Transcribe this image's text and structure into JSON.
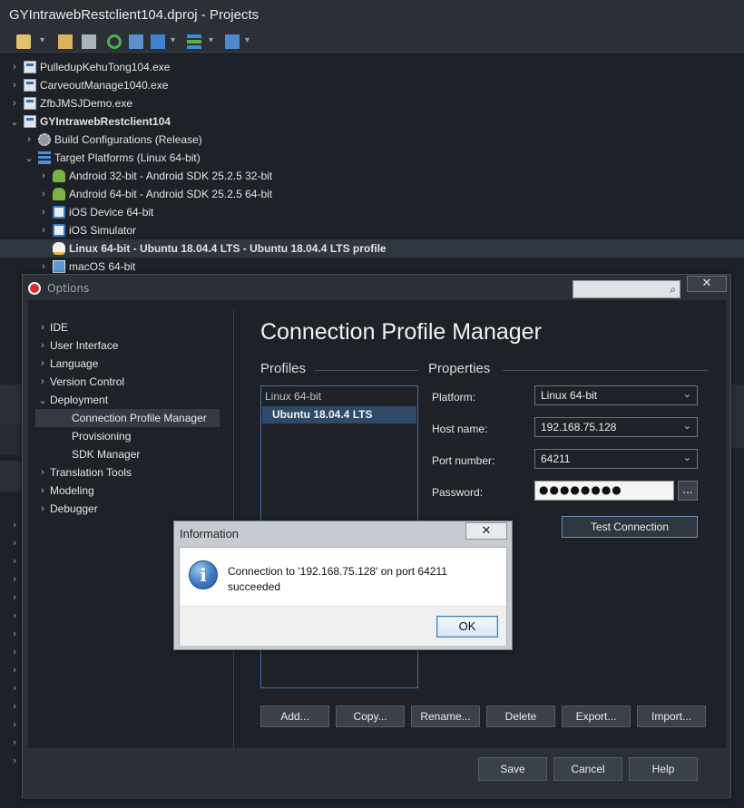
{
  "window": {
    "title": "GYIntrawebRestclient104.dproj - Projects"
  },
  "toolbar": {
    "icons": [
      "new-icon",
      "add-icon",
      "open-icon",
      "refresh-icon",
      "build-icon",
      "check-icon",
      "layers-icon",
      "deploy-icon"
    ]
  },
  "tree": {
    "items": [
      {
        "label": "PulledupKehuTong104.exe"
      },
      {
        "label": "CarveoutManage1040.exe"
      },
      {
        "label": "ZfbJMSJDemo.exe"
      },
      {
        "label": "GYIntrawebRestclient104"
      },
      {
        "label": "Build Configurations (Release)"
      },
      {
        "label": "Target Platforms (Linux 64-bit)"
      },
      {
        "label": "Android 32-bit - Android SDK 25.2.5 32-bit"
      },
      {
        "label": "Android 64-bit - Android SDK 25.2.5 64-bit"
      },
      {
        "label": "iOS Device 64-bit"
      },
      {
        "label": "iOS Simulator"
      },
      {
        "label": "Linux 64-bit - Ubuntu 18.04.4 LTS - Ubuntu 18.04.4 LTS profile"
      },
      {
        "label": "macOS 64-bit"
      }
    ]
  },
  "options": {
    "title": "Options",
    "search_placeholder": "",
    "close_label": "✕",
    "nav": [
      {
        "label": "IDE"
      },
      {
        "label": "User Interface"
      },
      {
        "label": "Language"
      },
      {
        "label": "Version Control"
      },
      {
        "label": "Deployment"
      },
      {
        "label": "Connection Profile Manager"
      },
      {
        "label": "Provisioning"
      },
      {
        "label": "SDK Manager"
      },
      {
        "label": "Translation Tools"
      },
      {
        "label": "Modeling"
      },
      {
        "label": "Debugger"
      }
    ],
    "page_title": "Connection Profile Manager",
    "profiles_heading": "Profiles",
    "properties_heading": "Properties",
    "profiles": {
      "group": "Linux 64-bit",
      "selected": "Ubuntu 18.04.4 LTS"
    },
    "properties": {
      "platform_label": "Platform:",
      "platform_value": "Linux 64-bit",
      "host_label": "Host name:",
      "host_value": "192.168.75.128",
      "port_label": "Port number:",
      "port_value": "64211",
      "password_label": "Password:",
      "password_value": "●●●●●●●●",
      "browse_label": "...",
      "test_label": "Test Connection"
    },
    "profile_buttons": {
      "add": "Add...",
      "copy": "Copy...",
      "rename": "Rename...",
      "delete": "Delete",
      "export": "Export...",
      "import": "Import..."
    },
    "footer": {
      "save": "Save",
      "cancel": "Cancel",
      "help": "Help"
    }
  },
  "dialog": {
    "title": "Information",
    "close_label": "✕",
    "message": "Connection to '192.168.75.128' on port 64211 succeeded",
    "ok": "OK",
    "icon": "info-icon"
  }
}
